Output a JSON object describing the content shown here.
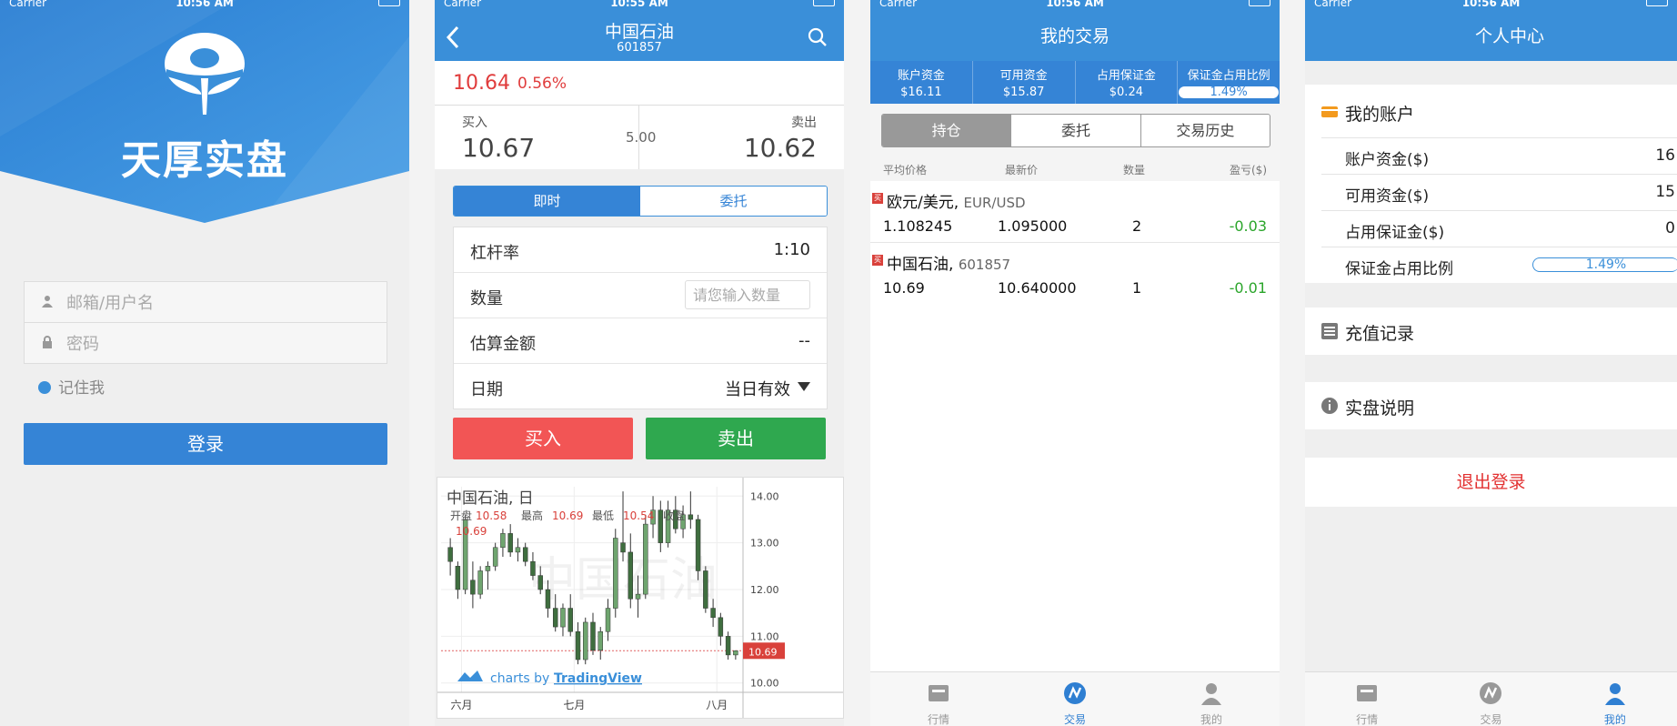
{
  "statusbar": {
    "carrier": "Carrier",
    "time1": "10:56 AM",
    "time2": "10:55 AM",
    "time3": "10:56 AM",
    "time4": "10:56 AM"
  },
  "login": {
    "brand": "天厚实盘",
    "username_placeholder": "邮箱/用户名",
    "password_placeholder": "密码",
    "remember": "记住我",
    "login_button": "登录"
  },
  "trade": {
    "title": "中国石油",
    "code": "601857",
    "price": "10.64",
    "change_pct": "0.56%",
    "buy_label": "买入",
    "buy_price": "10.67",
    "spread": "5.00",
    "sell_label": "卖出",
    "sell_price": "10.62",
    "tabs": [
      "即时",
      "委托"
    ],
    "form": {
      "leverage_label": "杠杆率",
      "leverage_value": "1:10",
      "qty_label": "数量",
      "qty_placeholder": "请您输入数量",
      "amount_label": "估算金额",
      "amount_value": "--",
      "date_label": "日期",
      "date_value": "当日有效"
    },
    "buy_button": "买入",
    "sell_button": "卖出",
    "chart": {
      "title": "中国石油, 日",
      "ohlc_open_label": "开盘",
      "ohlc_open": "10.58",
      "ohlc_high_label": "最高",
      "ohlc_high": "10.69",
      "ohlc_low_label": "最低",
      "ohlc_low": "10.54",
      "ohlc_close_label": "收盘",
      "ohlc_close": "10.69",
      "watermark": "中国石油",
      "credit_prefix": "charts by",
      "credit_link": "TradingView",
      "last_price_tag": "10.69"
    }
  },
  "chart_data": {
    "type": "candlestick",
    "title": "中国石油, 日",
    "ylim": [
      9.8,
      14.2
    ],
    "y_ticks": [
      "14.00",
      "13.00",
      "12.00",
      "11.00",
      "10.00"
    ],
    "x_ticks": [
      "六月",
      "七月",
      "八月"
    ],
    "last_price": 10.69,
    "candles": [
      {
        "o": 12.9,
        "h": 13.1,
        "l": 12.3,
        "c": 12.6
      },
      {
        "o": 12.5,
        "h": 12.6,
        "l": 11.8,
        "c": 12.0
      },
      {
        "o": 12.0,
        "h": 13.6,
        "l": 11.9,
        "c": 13.5
      },
      {
        "o": 12.2,
        "h": 12.6,
        "l": 11.6,
        "c": 11.9
      },
      {
        "o": 11.9,
        "h": 12.5,
        "l": 11.8,
        "c": 12.4
      },
      {
        "o": 12.4,
        "h": 12.6,
        "l": 12.0,
        "c": 12.5
      },
      {
        "o": 12.5,
        "h": 13.0,
        "l": 12.4,
        "c": 12.9
      },
      {
        "o": 12.9,
        "h": 13.3,
        "l": 12.7,
        "c": 13.2
      },
      {
        "o": 13.2,
        "h": 13.4,
        "l": 12.7,
        "c": 12.8
      },
      {
        "o": 12.8,
        "h": 13.1,
        "l": 12.6,
        "c": 12.9
      },
      {
        "o": 12.9,
        "h": 13.0,
        "l": 12.5,
        "c": 12.6
      },
      {
        "o": 12.6,
        "h": 12.8,
        "l": 12.2,
        "c": 12.3
      },
      {
        "o": 12.3,
        "h": 12.5,
        "l": 11.9,
        "c": 12.0
      },
      {
        "o": 12.0,
        "h": 12.2,
        "l": 11.4,
        "c": 11.6
      },
      {
        "o": 11.6,
        "h": 11.9,
        "l": 11.1,
        "c": 11.2
      },
      {
        "o": 11.2,
        "h": 11.7,
        "l": 11.0,
        "c": 11.6
      },
      {
        "o": 11.6,
        "h": 11.9,
        "l": 11.0,
        "c": 11.1
      },
      {
        "o": 11.1,
        "h": 11.3,
        "l": 10.4,
        "c": 10.5
      },
      {
        "o": 10.5,
        "h": 11.4,
        "l": 10.4,
        "c": 11.3
      },
      {
        "o": 11.3,
        "h": 11.5,
        "l": 10.6,
        "c": 10.7
      },
      {
        "o": 10.7,
        "h": 11.2,
        "l": 10.5,
        "c": 11.1
      },
      {
        "o": 11.1,
        "h": 11.8,
        "l": 10.9,
        "c": 11.6
      },
      {
        "o": 11.6,
        "h": 13.3,
        "l": 11.4,
        "c": 13.1
      },
      {
        "o": 13.0,
        "h": 14.1,
        "l": 12.6,
        "c": 12.8
      },
      {
        "o": 12.8,
        "h": 13.2,
        "l": 11.6,
        "c": 11.8
      },
      {
        "o": 11.8,
        "h": 12.3,
        "l": 11.4,
        "c": 11.9
      },
      {
        "o": 11.9,
        "h": 13.6,
        "l": 11.8,
        "c": 13.4
      },
      {
        "o": 13.4,
        "h": 14.0,
        "l": 13.1,
        "c": 13.7
      },
      {
        "o": 13.7,
        "h": 13.9,
        "l": 12.8,
        "c": 13.0
      },
      {
        "o": 13.0,
        "h": 13.9,
        "l": 12.9,
        "c": 13.7
      },
      {
        "o": 13.7,
        "h": 14.0,
        "l": 13.2,
        "c": 13.3
      },
      {
        "o": 13.3,
        "h": 13.8,
        "l": 13.1,
        "c": 13.6
      },
      {
        "o": 13.6,
        "h": 14.1,
        "l": 13.3,
        "c": 13.5
      },
      {
        "o": 13.5,
        "h": 13.6,
        "l": 12.2,
        "c": 12.4
      },
      {
        "o": 12.4,
        "h": 12.5,
        "l": 11.5,
        "c": 11.6
      },
      {
        "o": 11.6,
        "h": 11.8,
        "l": 11.2,
        "c": 11.4
      },
      {
        "o": 11.4,
        "h": 11.5,
        "l": 10.8,
        "c": 11.0
      },
      {
        "o": 11.0,
        "h": 11.1,
        "l": 10.5,
        "c": 10.6
      },
      {
        "o": 10.6,
        "h": 10.7,
        "l": 10.5,
        "c": 10.69
      }
    ]
  },
  "mytrade": {
    "title": "我的交易",
    "account": [
      {
        "k": "账户资金",
        "v": "$16.11"
      },
      {
        "k": "可用资金",
        "v": "$15.87"
      },
      {
        "k": "占用保证金",
        "v": "$0.24"
      },
      {
        "k": "保证金占用比例",
        "v": "1.49%"
      }
    ],
    "tabs": [
      "持仓",
      "委托",
      "交易历史"
    ],
    "columns": [
      "平均价格",
      "最新价",
      "数量",
      "盈亏($)"
    ],
    "positions": [
      {
        "tag": "买",
        "name": "欧元/美元,",
        "code": "EUR/USD",
        "avg": "1.108245",
        "last": "1.095000",
        "qty": "2",
        "pl": "-0.03"
      },
      {
        "tag": "买",
        "name": "中国石油,",
        "code": "601857",
        "avg": "10.69",
        "last": "10.640000",
        "qty": "1",
        "pl": "-0.01"
      }
    ]
  },
  "tabbar": [
    "行情",
    "交易",
    "我的"
  ],
  "profile": {
    "title": "个人中心",
    "my_account": "我的账户",
    "rows": [
      {
        "k": "账户资金($)",
        "v": "16"
      },
      {
        "k": "可用资金($)",
        "v": "15"
      },
      {
        "k": "占用保证金($)",
        "v": "0"
      },
      {
        "k": "保证金占用比例",
        "v": "1.49%"
      }
    ],
    "recharge": "充值记录",
    "about": "实盘说明",
    "logout": "退出登录"
  },
  "colors": {
    "primary": "#3584d6",
    "buy": "#f25555",
    "sell": "#2fa84f",
    "up": "#d9413b",
    "down": "#2aa52a"
  }
}
